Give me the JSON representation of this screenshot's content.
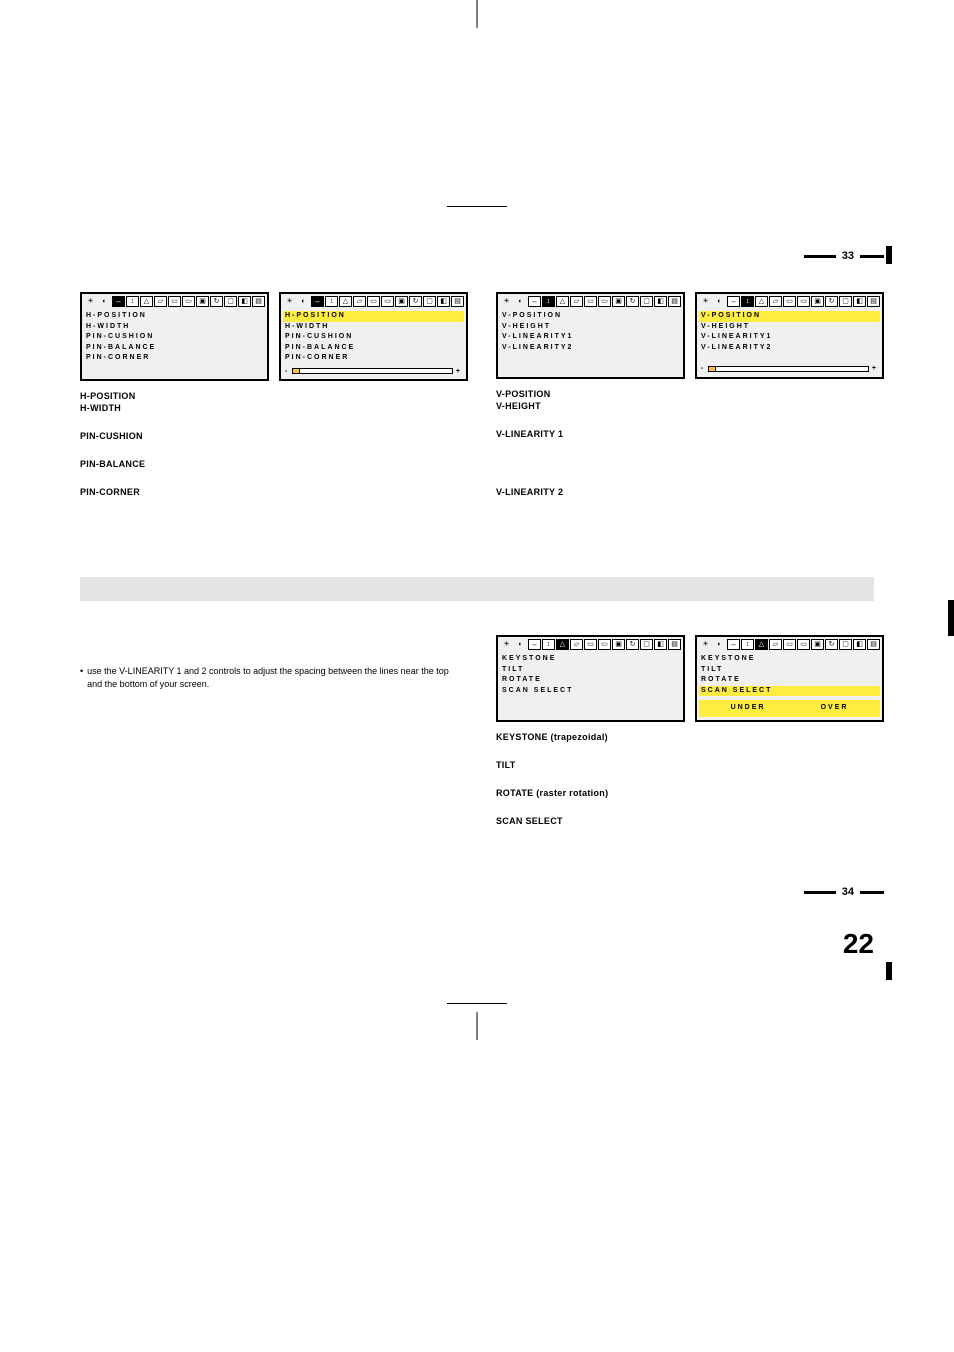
{
  "page33": {
    "number": "33",
    "left": {
      "osd1_items": [
        "H-POSITION",
        "H-WIDTH",
        "PIN-CUSHION",
        "PIN-BALANCE",
        "PIN-CORNER"
      ],
      "osd2_items": [
        "H-POSITION",
        "H-WIDTH",
        "PIN-CUSHION",
        "PIN-BALANCE",
        "PIN-CORNER"
      ],
      "terms": {
        "hpos": "H-POSITION",
        "hwidth": "H-WIDTH",
        "pincush": "PIN-CUSHION",
        "pinbal": "PIN-BALANCE",
        "pincorn": "PIN-CORNER"
      }
    },
    "right": {
      "osd1_items": [
        "V-POSITION",
        "V-HEIGHT",
        "V-LINEARITY1",
        "V-LINEARITY2"
      ],
      "osd2_items": [
        "V-POSITION",
        "V-HEIGHT",
        "V-LINEARITY1",
        "V-LINEARITY2"
      ],
      "terms": {
        "vpos": "V-POSITION",
        "vheight": "V-HEIGHT",
        "vlin1": "V-LINEARITY 1",
        "vlin2": "V-LINEARITY 2"
      }
    }
  },
  "page34": {
    "number": "34",
    "big_page": "22",
    "note_text": "use the V-LINEARITY 1 and 2 controls to adjust the spacing between the lines near the top and the bottom of your screen.",
    "right": {
      "osd1_items": [
        "KEYSTONE",
        "TILT",
        "ROTATE",
        "SCAN SELECT"
      ],
      "osd2_items": [
        "KEYSTONE",
        "TILT",
        "ROTATE",
        "SCAN SELECT"
      ],
      "osd2_sub": {
        "under": "UNDER",
        "over": "OVER"
      },
      "terms": {
        "keystone": "KEYSTONE (trapezoidal)",
        "tilt": "TILT",
        "rotate": "ROTATE (raster rotation)",
        "scan": "SCAN SELECT"
      }
    }
  },
  "icons": [
    "☀",
    "◐",
    "↔",
    "↕",
    "△",
    "▱",
    "▭",
    "▭",
    "▣",
    "↻",
    "▢",
    "◧",
    "▤"
  ]
}
